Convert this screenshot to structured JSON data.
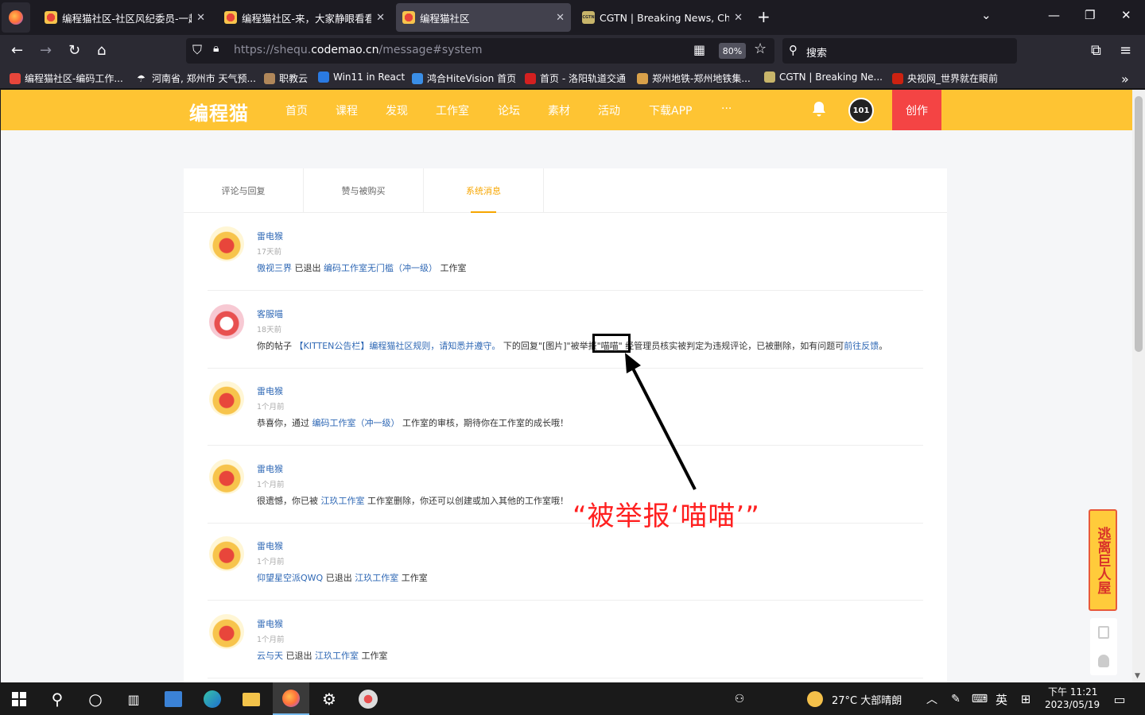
{
  "tabs": [
    {
      "title": "编程猫社区-社区风纪委员-一起",
      "favicon": "cat"
    },
    {
      "title": "编程猫社区-来，大家静眼看看",
      "favicon": "cat"
    },
    {
      "title": "编程猫社区",
      "favicon": "cat",
      "active": true
    },
    {
      "title": "CGTN | Breaking News, China",
      "favicon": "cgtn"
    }
  ],
  "cgtn_fav_text": "CGTN",
  "url": {
    "prefix": "https://shequ.",
    "domain": "codemao.cn",
    "path": "/message#system"
  },
  "zoom": "80%",
  "search_placeholder": "搜索",
  "bookmarks": [
    "编程猫社区-编码工作...",
    "河南省, 郑州市 天气预...",
    "职教云",
    "Win11 in React",
    "鸿合HiteVision 首页",
    "首页 - 洛阳轨道交通",
    "郑州地铁-郑州地铁集...",
    "CGTN | Breaking Ne...",
    "央视网_世界就在眼前"
  ],
  "site": {
    "logo": "编程猫",
    "nav": [
      "首页",
      "课程",
      "发现",
      "工作室",
      "论坛",
      "素材",
      "活动",
      "下载APP",
      "···"
    ],
    "avatar_text": "101",
    "create": "创作"
  },
  "message_tabs": [
    "评论与回复",
    "赞与被购买",
    "系统消息"
  ],
  "messages": [
    {
      "name": "雷电猴",
      "time": "17天前",
      "avatar": "fox",
      "parts": [
        {
          "t": " 傲视三界",
          "link": true
        },
        {
          "t": " 已退出 "
        },
        {
          "t": "编码工作室无门槛（冲一级）",
          "link": true
        },
        {
          "t": " 工作室"
        }
      ]
    },
    {
      "name": "客服喵",
      "time": "18天前",
      "avatar": "cat",
      "parts": [
        {
          "t": "你的帖子 "
        },
        {
          "t": "【KITTEN公告栏】编程猫社区规则，请知悉并遵守。",
          "link": true
        },
        {
          "t": " 下的回复\"[图片]\"被举报\"喵喵\" 经管理员核实被判定为违规评论，已被删除，如有问题可"
        },
        {
          "t": "前往反馈",
          "link": true
        },
        {
          "t": "。"
        }
      ]
    },
    {
      "name": "雷电猴",
      "time": "1个月前",
      "avatar": "fox",
      "parts": [
        {
          "t": "恭喜你，通过 "
        },
        {
          "t": "编码工作室（冲一级）",
          "link": true
        },
        {
          "t": " 工作室的审核，期待你在工作室的成长哦！"
        }
      ]
    },
    {
      "name": "雷电猴",
      "time": "1个月前",
      "avatar": "fox",
      "parts": [
        {
          "t": "很遗憾，你已被 "
        },
        {
          "t": "江玖工作室",
          "link": true
        },
        {
          "t": " 工作室删除，你还可以创建或加入其他的工作室哦！"
        }
      ]
    },
    {
      "name": "雷电猴",
      "time": "1个月前",
      "avatar": "fox",
      "parts": [
        {
          "t": " 仰望星空派QWQ",
          "link": true
        },
        {
          "t": " 已退出 "
        },
        {
          "t": "江玖工作室",
          "link": true
        },
        {
          "t": " 工作室"
        }
      ]
    },
    {
      "name": "雷电猴",
      "time": "1个月前",
      "avatar": "fox",
      "parts": [
        {
          "t": " 云与天",
          "link": true
        },
        {
          "t": " 已退出 "
        },
        {
          "t": "江玖工作室",
          "link": true
        },
        {
          "t": " 工作室"
        }
      ]
    }
  ],
  "annotation": "“被举报‘喵喵’”",
  "float_ad": "逃离巨人屋",
  "taskbar": {
    "weather": "27°C 大部晴朗",
    "ime": "英",
    "time": "下午 11:21",
    "date": "2023/05/19"
  }
}
